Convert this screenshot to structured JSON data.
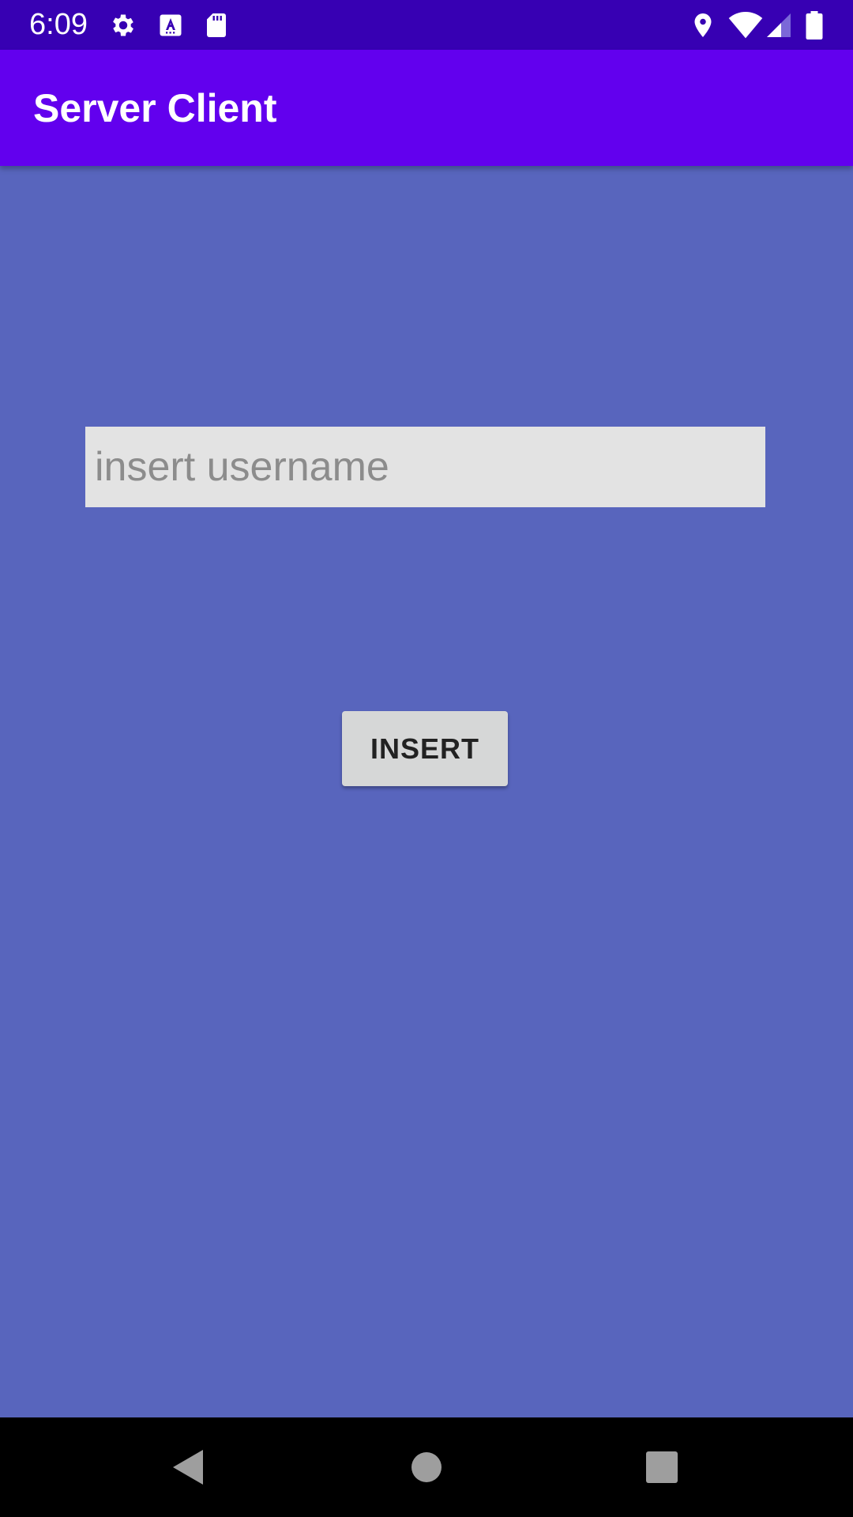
{
  "status_bar": {
    "time": "6:09",
    "left_icons": [
      "gear-icon",
      "font-a-icon",
      "sd-card-icon"
    ],
    "right_icons": [
      "location-icon",
      "wifi-icon",
      "signal-icon",
      "battery-icon"
    ],
    "background": "#3700b3"
  },
  "app_bar": {
    "title": "Server Client",
    "background": "#6200ee"
  },
  "main": {
    "background": "#5865bd",
    "username_input": {
      "placeholder": "insert username",
      "value": ""
    },
    "insert_button": {
      "label": "INSERT"
    }
  },
  "nav_bar": {
    "buttons": [
      "back-icon",
      "home-icon",
      "recents-icon"
    ]
  }
}
